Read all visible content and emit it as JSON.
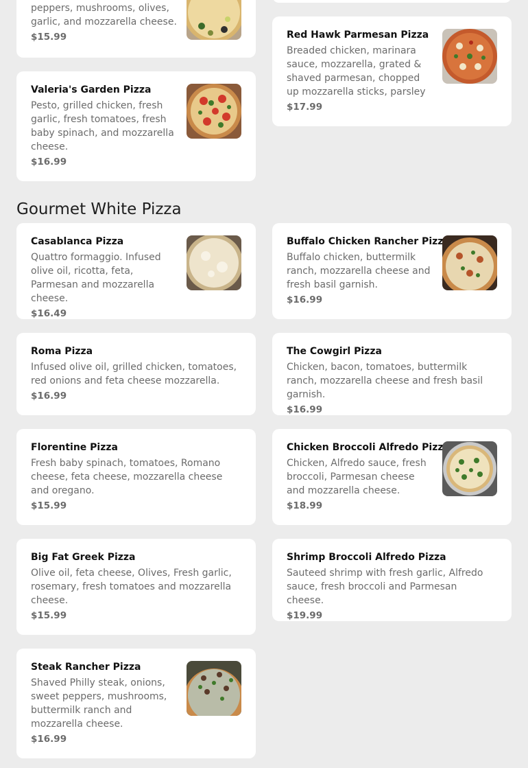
{
  "top_partial": {
    "left": {
      "desc": "peppers, mushrooms, olives, garlic, and mozzarella cheese.",
      "price": "$15.99"
    }
  },
  "items_top": [
    {
      "name": "Valeria's Garden Pizza",
      "desc": "Pesto, grilled chicken, fresh garlic, fresh tomatoes, fresh baby spinach, and mozzarella cheese.",
      "price": "$16.99"
    },
    {
      "name": "Red Hawk Parmesan Pizza",
      "desc": "Breaded chicken, marinara sauce, mozzarella, grated & shaved parmesan, chopped up mozzarella sticks, parsley",
      "price": "$17.99"
    }
  ],
  "section": {
    "title": "Gourmet White Pizza"
  },
  "items": [
    {
      "name": "Casablanca Pizza",
      "desc": "Quattro formaggio. Infused olive oil, ricotta, feta, Parmesan and mozzarella cheese.",
      "price": "$16.49"
    },
    {
      "name": "Buffalo Chicken Rancher Pizza",
      "desc": "Buffalo chicken, buttermilk ranch, mozzarella cheese and fresh basil garnish.",
      "price": "$16.99"
    },
    {
      "name": "Roma Pizza",
      "desc": "Infused olive oil, grilled chicken, tomatoes, red onions and feta cheese mozzarella.",
      "price": "$16.99"
    },
    {
      "name": "The Cowgirl Pizza",
      "desc": "Chicken, bacon, tomatoes, buttermilk ranch, mozzarella cheese and fresh basil garnish.",
      "price": "$16.99"
    },
    {
      "name": "Florentine Pizza",
      "desc": "Fresh baby spinach, tomatoes, Romano cheese, feta cheese, mozzarella cheese and oregano.",
      "price": "$15.99"
    },
    {
      "name": "Chicken Broccoli Alfredo Pizza",
      "desc": "Chicken, Alfredo sauce, fresh broccoli, Parmesan cheese and mozzarella cheese.",
      "price": "$18.99"
    },
    {
      "name": "Big Fat Greek Pizza",
      "desc": "Olive oil, feta cheese, Olives, Fresh garlic, rosemary, fresh tomatoes and mozzarella cheese.",
      "price": "$15.99"
    },
    {
      "name": "Shrimp Broccoli Alfredo Pizza",
      "desc": "Sauteed shrimp with fresh garlic, Alfredo sauce, fresh broccoli and Parmesan cheese.",
      "price": "$19.99"
    },
    {
      "name": "Steak Rancher Pizza",
      "desc": "Shaved Philly steak, onions, sweet peppers, mushrooms, buttermilk ranch and mozzarella cheese.",
      "price": "$16.99"
    }
  ],
  "colors": {
    "page_bg": "#ececec",
    "card_bg": "#ffffff",
    "text_dark": "#111111",
    "text_muted": "#6b6b6b"
  }
}
